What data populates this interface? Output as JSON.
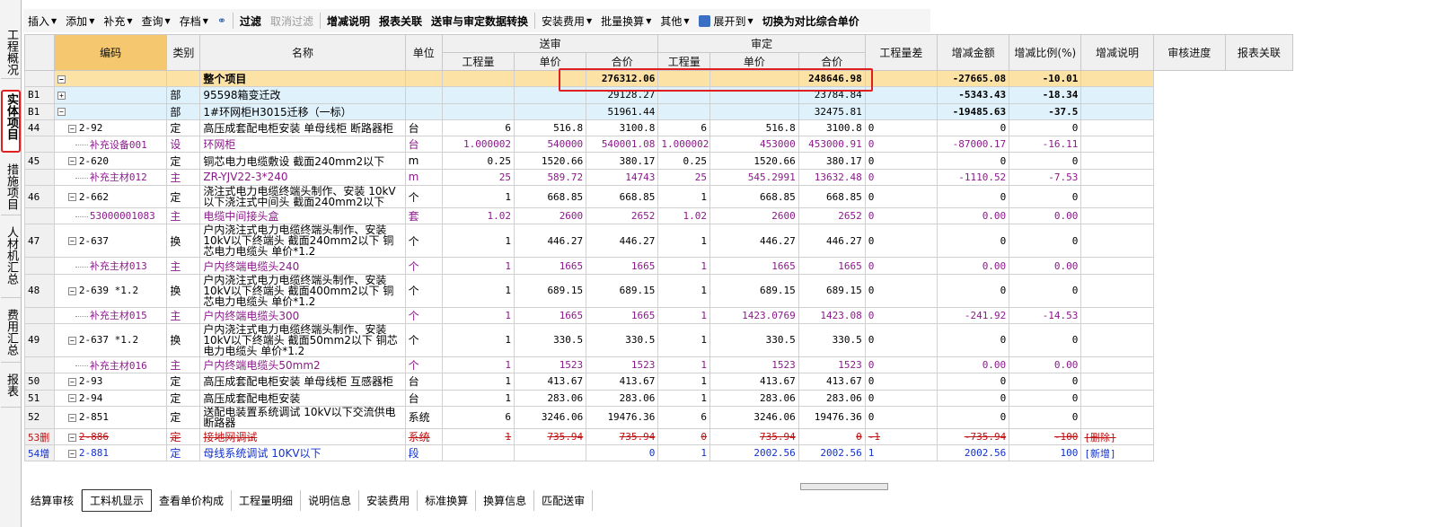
{
  "left_tabs": [
    {
      "label": "工程概况",
      "active": false
    },
    {
      "label": "实体项目",
      "active": true
    },
    {
      "label": "措施项目",
      "active": false
    },
    {
      "label": "人材机汇总",
      "active": false
    },
    {
      "label": "费用汇总",
      "active": false
    },
    {
      "label": "报表",
      "active": false
    }
  ],
  "toolbar": {
    "insert": "插入",
    "add": "添加",
    "supplement": "补充",
    "query": "查询",
    "archive": "存档",
    "filter": "过滤",
    "cancel_filter": "取消过滤",
    "increase_decrease_note": "增减说明",
    "report_link": "报表关联",
    "convert": "送审与审定数据转换",
    "install_fee": "安装费用",
    "batch_convert": "批量换算",
    "other": "其他",
    "expand_to": "展开到",
    "switch_to_compare": "切换为对比综合单价"
  },
  "grid": {
    "headers": {
      "code": "编码",
      "category": "类别",
      "name": "名称",
      "unit": "单位",
      "submitted": "送审",
      "approved": "审定",
      "qty": "工程量",
      "unit_price": "单价",
      "total": "合价",
      "qty_diff": "工程量差",
      "change_amount": "增减金额",
      "change_ratio": "增减比例(%)",
      "change_note": "增减说明",
      "review_progress": "审核进度",
      "report_link": "报表关联"
    },
    "rows": [
      {
        "idx": "",
        "code": "",
        "cat": "",
        "name": "整个项目",
        "unit": "",
        "sq": "",
        "sp": "",
        "st": "276312.06",
        "aq": "",
        "ap": "",
        "at": "248646.98",
        "qd": "",
        "ca": "-27665.08",
        "cr": "-10.01",
        "note": ""
      },
      {
        "idx": "B1",
        "code": "",
        "cat": "部",
        "name": "95598箱变迁改",
        "unit": "",
        "sq": "",
        "sp": "",
        "st": "29128.27",
        "aq": "",
        "ap": "",
        "at": "23784.84",
        "qd": "",
        "ca": "-5343.43",
        "cr": "-18.34",
        "note": ""
      },
      {
        "idx": "B1",
        "code": "",
        "cat": "部",
        "name": "1#环网柜H3015迁移（一标）",
        "unit": "",
        "sq": "",
        "sp": "",
        "st": "51961.44",
        "aq": "",
        "ap": "",
        "at": "32475.81",
        "qd": "",
        "ca": "-19485.63",
        "cr": "-37.5",
        "note": ""
      },
      {
        "idx": "44",
        "code": "2-92",
        "cat": "定",
        "name": "高压成套配电柜安装 单母线柜 断路器柜",
        "unit": "台",
        "sq": "6",
        "sp": "516.8",
        "st": "3100.8",
        "aq": "6",
        "ap": "516.8",
        "at": "3100.8",
        "qd": "0",
        "ca": "0",
        "cr": "0",
        "note": ""
      },
      {
        "idx": "",
        "code": "补充设备001",
        "cat": "设",
        "name": "环网柜",
        "unit": "台",
        "sq": "1.000002",
        "sp": "540000",
        "st": "540001.08",
        "aq": "1.000002",
        "ap": "453000",
        "at": "453000.91",
        "qd": "0",
        "ca": "-87000.17",
        "cr": "-16.11",
        "note": ""
      },
      {
        "idx": "45",
        "code": "2-620",
        "cat": "定",
        "name": "铜芯电力电缆敷设 截面240mm2以下",
        "unit": "m",
        "sq": "0.25",
        "sp": "1520.66",
        "st": "380.17",
        "aq": "0.25",
        "ap": "1520.66",
        "at": "380.17",
        "qd": "0",
        "ca": "0",
        "cr": "0",
        "note": ""
      },
      {
        "idx": "",
        "code": "补充主材012",
        "cat": "主",
        "name": "ZR-YJV22-3*240",
        "unit": "m",
        "sq": "25",
        "sp": "589.72",
        "st": "14743",
        "aq": "25",
        "ap": "545.2991",
        "at": "13632.48",
        "qd": "0",
        "ca": "-1110.52",
        "cr": "-7.53",
        "note": ""
      },
      {
        "idx": "46",
        "code": "2-662",
        "cat": "定",
        "name": "浇注式电力电缆终端头制作、安装 10kV以下浇注式中间头 截面240mm2以下",
        "unit": "个",
        "sq": "1",
        "sp": "668.85",
        "st": "668.85",
        "aq": "1",
        "ap": "668.85",
        "at": "668.85",
        "qd": "0",
        "ca": "0",
        "cr": "0",
        "note": ""
      },
      {
        "idx": "",
        "code": "53000001083",
        "cat": "主",
        "name": "电缆中间接头盒",
        "unit": "套",
        "sq": "1.02",
        "sp": "2600",
        "st": "2652",
        "aq": "1.02",
        "ap": "2600",
        "at": "2652",
        "qd": "0",
        "ca": "0.00",
        "cr": "0.00",
        "note": ""
      },
      {
        "idx": "47",
        "code": "2-637",
        "cat": "换",
        "name": "户内浇注式电力电缆终端头制作、安装 10kV以下终端头 截面240mm2以下 铜芯电力电缆头 单价*1.2",
        "unit": "个",
        "sq": "1",
        "sp": "446.27",
        "st": "446.27",
        "aq": "1",
        "ap": "446.27",
        "at": "446.27",
        "qd": "0",
        "ca": "0",
        "cr": "0",
        "note": ""
      },
      {
        "idx": "",
        "code": "补充主材013",
        "cat": "主",
        "name": "户内终端电缆头240",
        "unit": "个",
        "sq": "1",
        "sp": "1665",
        "st": "1665",
        "aq": "1",
        "ap": "1665",
        "at": "1665",
        "qd": "0",
        "ca": "0.00",
        "cr": "0.00",
        "note": ""
      },
      {
        "idx": "48",
        "code": "2-639 *1.2",
        "cat": "换",
        "name": "户内浇注式电力电缆终端头制作、安装 10kV以下终端头 截面400mm2以下 铜芯电力电缆头 单价*1.2",
        "unit": "个",
        "sq": "1",
        "sp": "689.15",
        "st": "689.15",
        "aq": "1",
        "ap": "689.15",
        "at": "689.15",
        "qd": "0",
        "ca": "0",
        "cr": "0",
        "note": ""
      },
      {
        "idx": "",
        "code": "补充主材015",
        "cat": "主",
        "name": "户内终端电缆头300",
        "unit": "个",
        "sq": "1",
        "sp": "1665",
        "st": "1665",
        "aq": "1",
        "ap": "1423.0769",
        "at": "1423.08",
        "qd": "0",
        "ca": "-241.92",
        "cr": "-14.53",
        "note": ""
      },
      {
        "idx": "49",
        "code": "2-637 *1.2",
        "cat": "换",
        "name": "户内浇注式电力电缆终端头制作、安装 10kV以下终端头 截面50mm2以下 铜芯电力电缆头 单价*1.2",
        "unit": "个",
        "sq": "1",
        "sp": "330.5",
        "st": "330.5",
        "aq": "1",
        "ap": "330.5",
        "at": "330.5",
        "qd": "0",
        "ca": "0",
        "cr": "0",
        "note": ""
      },
      {
        "idx": "",
        "code": "补充主材016",
        "cat": "主",
        "name": "户内终端电缆头50mm2",
        "unit": "个",
        "sq": "1",
        "sp": "1523",
        "st": "1523",
        "aq": "1",
        "ap": "1523",
        "at": "1523",
        "qd": "0",
        "ca": "0.00",
        "cr": "0.00",
        "note": ""
      },
      {
        "idx": "50",
        "code": "2-93",
        "cat": "定",
        "name": "高压成套配电柜安装 单母线柜 互感器柜",
        "unit": "台",
        "sq": "1",
        "sp": "413.67",
        "st": "413.67",
        "aq": "1",
        "ap": "413.67",
        "at": "413.67",
        "qd": "0",
        "ca": "0",
        "cr": "0",
        "note": ""
      },
      {
        "idx": "51",
        "code": "2-94",
        "cat": "定",
        "name": "高压成套配电柜安装",
        "unit": "台",
        "sq": "1",
        "sp": "283.06",
        "st": "283.06",
        "aq": "1",
        "ap": "283.06",
        "at": "283.06",
        "qd": "0",
        "ca": "0",
        "cr": "0",
        "note": ""
      },
      {
        "idx": "52",
        "code": "2-851",
        "cat": "定",
        "name": "送配电装置系统调试 10kV以下交流供电 断路器",
        "unit": "系统",
        "sq": "6",
        "sp": "3246.06",
        "st": "19476.36",
        "aq": "6",
        "ap": "3246.06",
        "at": "19476.36",
        "qd": "0",
        "ca": "0",
        "cr": "0",
        "note": ""
      },
      {
        "idx": "53删",
        "code": "2-886",
        "cat": "定",
        "name": "接地网调试",
        "unit": "系统",
        "sq": "1",
        "sp": "735.94",
        "st": "735.94",
        "aq": "0",
        "ap": "735.94",
        "at": "0",
        "qd": "-1",
        "ca": "-735.94",
        "cr": "-100",
        "note": "[删除]"
      },
      {
        "idx": "54增",
        "code": "2-881",
        "cat": "定",
        "name": "母线系统调试 10KV以下",
        "unit": "段",
        "sq": "",
        "sp": "",
        "st": "0",
        "aq": "1",
        "ap": "2002.56",
        "at": "2002.56",
        "qd": "1",
        "ca": "2002.56",
        "cr": "100",
        "note": "[新增]"
      }
    ]
  },
  "bottom_tabs": [
    {
      "label": "结算审核",
      "active": false
    },
    {
      "label": "工料机显示",
      "active": true
    },
    {
      "label": "查看单价构成",
      "active": false
    },
    {
      "label": "工程量明细",
      "active": false
    },
    {
      "label": "说明信息",
      "active": false
    },
    {
      "label": "安装费用",
      "active": false
    },
    {
      "label": "标准换算",
      "active": false
    },
    {
      "label": "换算信息",
      "active": false
    },
    {
      "label": "匹配送审",
      "active": false
    }
  ]
}
